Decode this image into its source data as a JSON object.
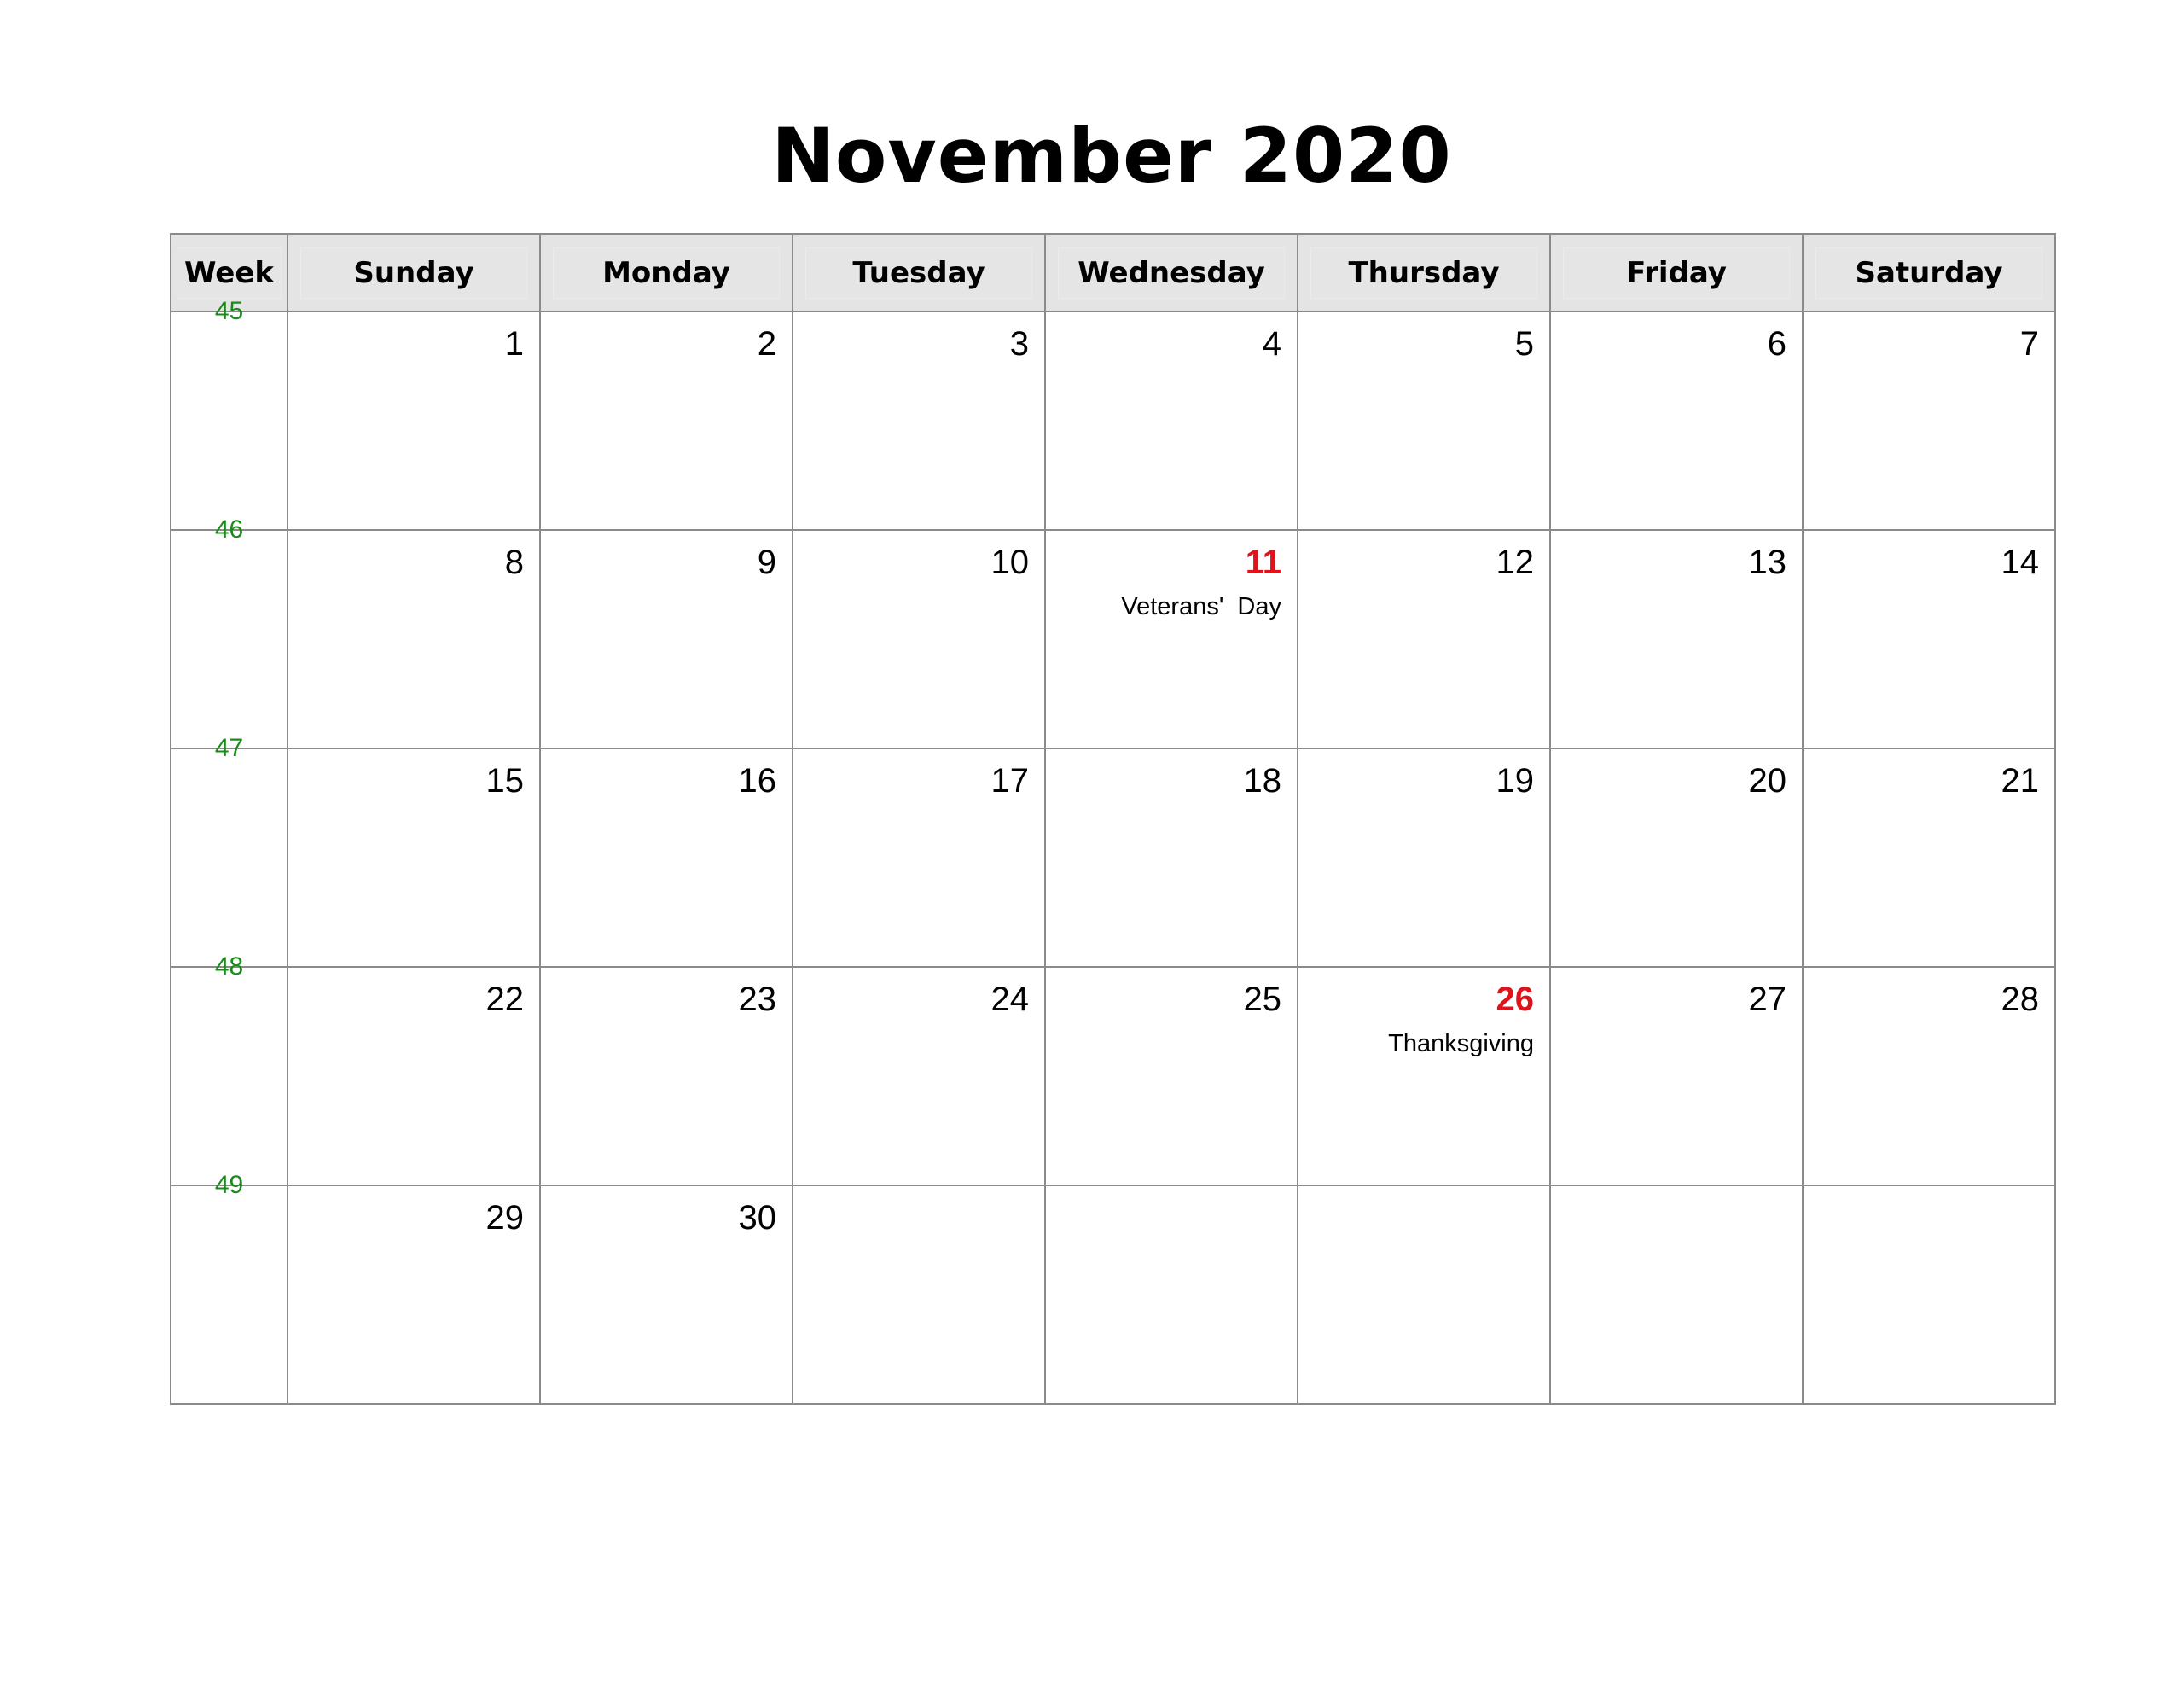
{
  "title": "November 2020",
  "header": {
    "week_label": "Week",
    "days": [
      "Sunday",
      "Monday",
      "Tuesday",
      "Wednesday",
      "Thursday",
      "Friday",
      "Saturday"
    ]
  },
  "colors": {
    "week_number": "#1a8a1a",
    "holiday_date": "#e0121a",
    "header_bg": "#e4e4e4",
    "grid_border": "#8a8a8a"
  },
  "weeks": [
    {
      "week": "45",
      "days": [
        {
          "date": "1"
        },
        {
          "date": "2"
        },
        {
          "date": "3"
        },
        {
          "date": "4"
        },
        {
          "date": "5"
        },
        {
          "date": "6"
        },
        {
          "date": "7"
        }
      ]
    },
    {
      "week": "46",
      "days": [
        {
          "date": "8"
        },
        {
          "date": "9"
        },
        {
          "date": "10"
        },
        {
          "date": "11",
          "holiday": "Veterans' Day"
        },
        {
          "date": "12"
        },
        {
          "date": "13"
        },
        {
          "date": "14"
        }
      ]
    },
    {
      "week": "47",
      "days": [
        {
          "date": "15"
        },
        {
          "date": "16"
        },
        {
          "date": "17"
        },
        {
          "date": "18"
        },
        {
          "date": "19"
        },
        {
          "date": "20"
        },
        {
          "date": "21"
        }
      ]
    },
    {
      "week": "48",
      "days": [
        {
          "date": "22"
        },
        {
          "date": "23"
        },
        {
          "date": "24"
        },
        {
          "date": "25"
        },
        {
          "date": "26",
          "holiday": "Thanksgiving"
        },
        {
          "date": "27"
        },
        {
          "date": "28"
        }
      ]
    },
    {
      "week": "49",
      "days": [
        {
          "date": "29"
        },
        {
          "date": "30"
        },
        {
          "date": ""
        },
        {
          "date": ""
        },
        {
          "date": ""
        },
        {
          "date": ""
        },
        {
          "date": ""
        }
      ]
    }
  ]
}
